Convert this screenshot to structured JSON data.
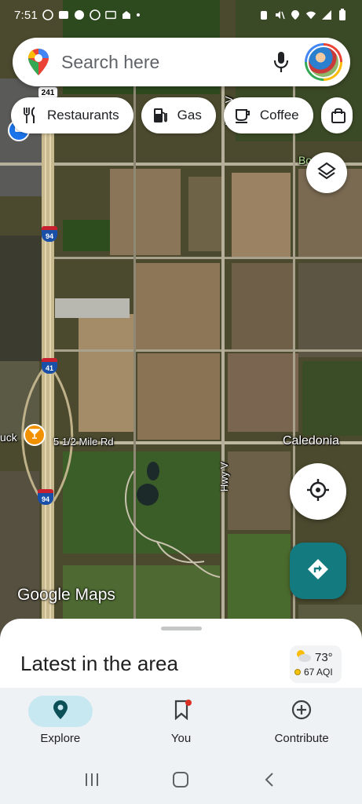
{
  "status_bar": {
    "time": "7:51"
  },
  "search": {
    "placeholder": "Search here"
  },
  "chips": [
    {
      "label": "Restaurants",
      "icon": "fork-knife-icon"
    },
    {
      "label": "Gas",
      "icon": "gas-pump-icon"
    },
    {
      "label": "Coffee",
      "icon": "coffee-cup-icon"
    },
    {
      "label": "",
      "icon": "shopping-bag-icon"
    }
  ],
  "map": {
    "labels": {
      "hwy_v_top": "Hwy V",
      "hwy_v_bottom": "Hwy V",
      "road_mile": "5 1/2 Mile Rd",
      "town": "Caledonia",
      "bar_partial": "uck",
      "top_right_partial": "Bo        w"
    },
    "shields": {
      "us_241": "241",
      "i94_top": "94",
      "i41": "41",
      "i94_bottom": "94"
    },
    "logo": "Google Maps"
  },
  "sheet": {
    "title": "Latest in the area",
    "weather_temp": "73°",
    "weather_aqi": "67 AQI"
  },
  "bottom_nav": {
    "items": [
      {
        "label": "Explore",
        "active": true
      },
      {
        "label": "You",
        "active": false
      },
      {
        "label": "Contribute",
        "active": false
      }
    ]
  },
  "colors": {
    "directions_button": "#137a7f",
    "explore_active_pill": "#c7e7f1",
    "poi_bar": "#f29100"
  }
}
